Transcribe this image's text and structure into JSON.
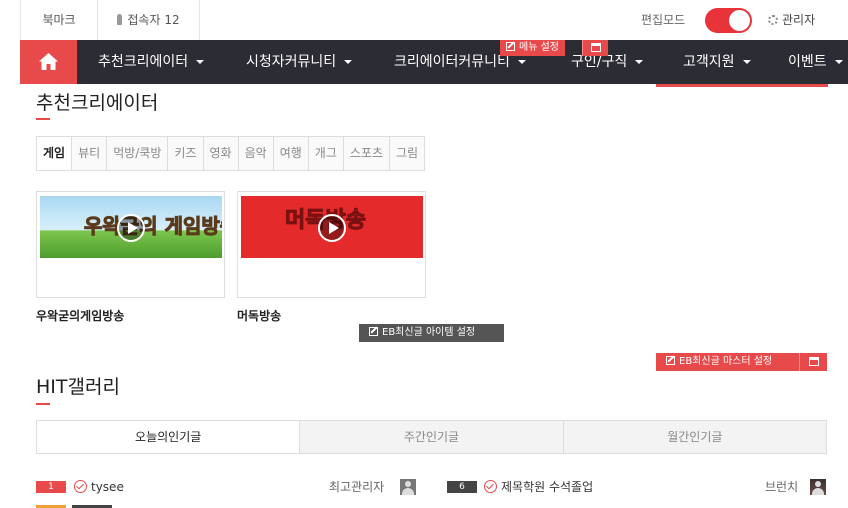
{
  "topbar": {
    "bookmark": "북마크",
    "visitors": "접속자 12",
    "edit_mode": "편집모드",
    "admin": "관리자",
    "edit_mode_on": true
  },
  "nav": {
    "home_icon": "home-icon",
    "items": [
      {
        "label": "추천크리에이터"
      },
      {
        "label": "시청자커뮤니티"
      },
      {
        "label": "크리에이터커뮤니티"
      },
      {
        "label": "구인/구직"
      },
      {
        "label": "고객지원"
      },
      {
        "label": "이벤트"
      }
    ],
    "menu_setting": "메뉴 설정"
  },
  "creators": {
    "title": "추천크리에이터",
    "tabs": [
      "게임",
      "뷰티",
      "먹방/쿡방",
      "키즈",
      "영화",
      "음악",
      "여행",
      "개그",
      "스포츠",
      "그림"
    ],
    "active_tab": "게임",
    "videos": [
      {
        "title": "우왁굳의게임방송",
        "thumb_text": "우왁굳의 게임방송"
      },
      {
        "title": "머독방송",
        "thumb_text": "머독방송"
      }
    ],
    "item_setting": "EB최신글 아이템 설정",
    "master_setting": "EB최신글 마스터 설정"
  },
  "gallery": {
    "title": "HIT갤러리",
    "tabs": [
      "오늘의인기글",
      "주간인기글",
      "월간인기글"
    ],
    "rows": [
      {
        "rank": "1",
        "title": "tysee",
        "author": "최고관리자"
      },
      {
        "rank": "6",
        "title": "제목학원 수석졸업",
        "author": "브런치"
      }
    ]
  },
  "colors": {
    "accent": "#e84a4c",
    "nav_bg": "#2c2c34"
  }
}
